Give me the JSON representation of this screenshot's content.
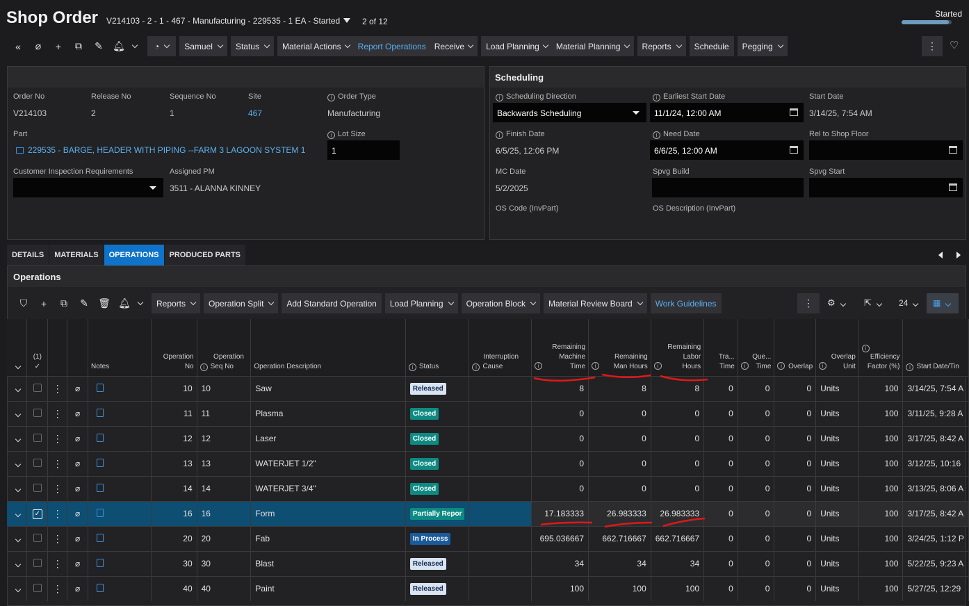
{
  "header": {
    "title": "Shop Order",
    "subtitle": "V214103 - 2 - 1 - 467 - Manufacturing - 229535 - 1 EA - Started",
    "count": "2 of 12",
    "state": "Started",
    "state_progress": 0.95
  },
  "toolbar": {
    "user": "Samuel",
    "status": "Status",
    "material_actions": "Material Actions",
    "report_operations": "Report Operations",
    "receive": "Receive",
    "load_planning": "Load Planning",
    "material_planning": "Material Planning",
    "reports": "Reports",
    "schedule": "Schedule",
    "pegging": "Pegging"
  },
  "order": {
    "order_no_label": "Order No",
    "order_no": "V214103",
    "release_no_label": "Release No",
    "release_no": "2",
    "sequence_no_label": "Sequence No",
    "sequence_no": "1",
    "site_label": "Site",
    "site": "467",
    "order_type_label": "Order Type",
    "order_type": "Manufacturing",
    "part_label": "Part",
    "part": "229535 - BARGE, HEADER WITH PIPING --FARM 3 LAGOON SYSTEM 1",
    "lot_size_label": "Lot Size",
    "lot_size": "1",
    "cust_insp_label": "Customer Inspection Requirements",
    "assigned_pm_label": "Assigned PM",
    "assigned_pm": "3511 - ALANNA KINNEY"
  },
  "scheduling": {
    "title": "Scheduling",
    "direction_label": "Scheduling Direction",
    "direction": "Backwards Scheduling",
    "earliest_start_label": "Earliest Start Date",
    "earliest_start": "11/1/24, 12:00 AM",
    "start_date_label": "Start Date",
    "start_date": "3/14/25, 7:54 AM",
    "finish_date_label": "Finish Date",
    "finish_date": "6/5/25, 12:06 PM",
    "need_date_label": "Need Date",
    "need_date": "6/6/25, 12:00 AM",
    "rel_shop_floor_label": "Rel to Shop Floor",
    "mc_date_label": "MC Date",
    "mc_date": "5/2/2025",
    "spvg_build_label": "Spvg Build",
    "spvg_start_label": "Spvg Start",
    "os_code_label": "OS Code (InvPart)",
    "os_desc_label": "OS Description (InvPart)"
  },
  "tabs": [
    "DETAILS",
    "MATERIALS",
    "OPERATIONS",
    "PRODUCED PARTS"
  ],
  "operations": {
    "title": "Operations",
    "toolbar": {
      "reports": "Reports",
      "operation_split": "Operation Split",
      "add_standard": "Add Standard Operation",
      "load_planning": "Load Planning",
      "operation_block": "Operation Block",
      "mrb": "Material Review Board",
      "work_guidelines": "Work Guidelines",
      "page_size": "24"
    },
    "selected_count": "(1)",
    "columns": {
      "notes": "Notes",
      "op_no": "Operation No",
      "op_seq": "Operation Seq No",
      "desc": "Operation Description",
      "status": "Status",
      "interruption": "Interruption Cause",
      "rem_machine": "Remaining Machine Time",
      "rem_man": "Remaining Man Hours",
      "rem_labor": "Remaining Labor Hours",
      "transport": "Tra... Time",
      "queue": "Que... Time",
      "overlap": "Overlap",
      "overlap_unit": "Overlap Unit",
      "efficiency": "Efficiency Factor (%)",
      "start_date": "Start Date/Tin"
    },
    "rows": [
      {
        "op_no": "10",
        "seq": "10",
        "desc": "Saw",
        "status": "Released",
        "rm": "8",
        "rmh": "8",
        "rlh": "8",
        "tr": "0",
        "q": "0",
        "ov": "0",
        "unit": "Units",
        "eff": "100",
        "start": "3/14/25, 7:54 A"
      },
      {
        "op_no": "11",
        "seq": "11",
        "desc": "Plasma",
        "status": "Closed",
        "rm": "0",
        "rmh": "0",
        "rlh": "0",
        "tr": "0",
        "q": "0",
        "ov": "0",
        "unit": "Units",
        "eff": "100",
        "start": "3/11/25, 9:28 A"
      },
      {
        "op_no": "12",
        "seq": "12",
        "desc": "Laser",
        "status": "Closed",
        "rm": "0",
        "rmh": "0",
        "rlh": "0",
        "tr": "0",
        "q": "0",
        "ov": "0",
        "unit": "Units",
        "eff": "100",
        "start": "3/17/25, 8:42 A"
      },
      {
        "op_no": "13",
        "seq": "13",
        "desc": "WATERJET 1/2\"",
        "status": "Closed",
        "rm": "0",
        "rmh": "0",
        "rlh": "0",
        "tr": "0",
        "q": "0",
        "ov": "0",
        "unit": "Units",
        "eff": "100",
        "start": "3/12/25, 10:16"
      },
      {
        "op_no": "14",
        "seq": "14",
        "desc": "WATERJET 3/4\"",
        "status": "Closed",
        "rm": "0",
        "rmh": "0",
        "rlh": "0",
        "tr": "0",
        "q": "0",
        "ov": "0",
        "unit": "Units",
        "eff": "100",
        "start": "3/13/25, 8:06 A"
      },
      {
        "op_no": "16",
        "seq": "16",
        "desc": "Form",
        "status": "Partially Repor",
        "rm": "17.183333",
        "rmh": "26.983333",
        "rlh": "26.983333",
        "tr": "0",
        "q": "0",
        "ov": "0",
        "unit": "Units",
        "eff": "100",
        "start": "3/17/25, 8:42 A"
      },
      {
        "op_no": "20",
        "seq": "20",
        "desc": "Fab",
        "status": "In Process",
        "rm": "695.036667",
        "rmh": "662.716667",
        "rlh": "662.716667",
        "tr": "0",
        "q": "0",
        "ov": "0",
        "unit": "Units",
        "eff": "100",
        "start": "3/24/25, 1:12 P"
      },
      {
        "op_no": "30",
        "seq": "30",
        "desc": "Blast",
        "status": "Released",
        "rm": "34",
        "rmh": "34",
        "rlh": "34",
        "tr": "0",
        "q": "0",
        "ov": "0",
        "unit": "Units",
        "eff": "100",
        "start": "5/22/25, 9:23 A"
      },
      {
        "op_no": "40",
        "seq": "40",
        "desc": "Paint",
        "status": "Released",
        "rm": "100",
        "rmh": "100",
        "rlh": "100",
        "tr": "0",
        "q": "0",
        "ov": "0",
        "unit": "Units",
        "eff": "100",
        "start": "5/27/25, 12:29"
      }
    ]
  },
  "colors": {
    "accent": "#0f73c9",
    "link": "#5ab0f0",
    "annotation": "#e01818"
  }
}
